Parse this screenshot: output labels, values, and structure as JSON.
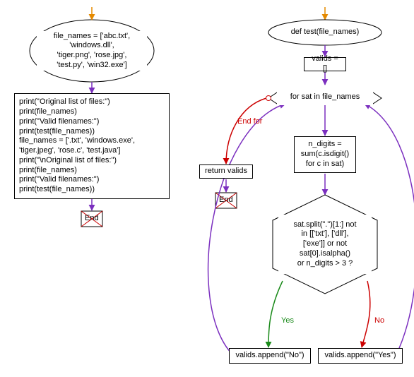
{
  "left": {
    "start_text": "file_names = ['abc.txt',\n'windows.dll',\n'tiger.png', 'rose.jpg',\n'test.py', 'win32.exe']",
    "body_text": "print(\"Original list of files:\")\nprint(file_names)\nprint(\"Valid filenames:\")\nprint(test(file_names))\nfile_names = ['.txt', 'windows.exe',\n'tiger.jpeg', 'rose.c', 'test.java']\nprint(\"\\nOriginal list of files:\")\nprint(file_names)\nprint(\"Valid filenames:\")\nprint(test(file_names))",
    "end": "End"
  },
  "right": {
    "def": "def test(file_names)",
    "init": "valids = []",
    "loop_header": "for sat in file_names",
    "return": "return valids",
    "end_for": "End for",
    "end": "End",
    "ndigits": "n_digits =\nsum(c.isdigit()\nfor c in sat)",
    "cond": "sat.split(\".\")[1:] not\nin [['txt'], ['dll'],\n['exe']] or not\nsat[0].isalpha()\nor n_digits > 3 ?",
    "yes": "Yes",
    "no": "No",
    "append_no": "valids.append(\"No\")",
    "append_yes": "valids.append(\"Yes\")"
  }
}
